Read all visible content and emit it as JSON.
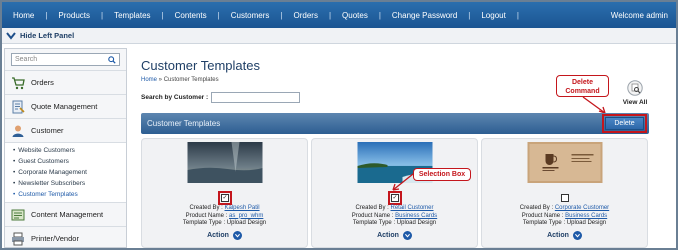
{
  "topnav": {
    "items": [
      "Home",
      "Products",
      "Templates",
      "Contents",
      "Customers",
      "Orders",
      "Quotes",
      "Change Password",
      "Logout"
    ],
    "welcome": "Welcome admin"
  },
  "hidebar": {
    "label": "Hide Left Panel"
  },
  "sidebar": {
    "search_placeholder": "Search",
    "items": [
      {
        "label": "Orders",
        "icon": "cart-icon"
      },
      {
        "label": "Quote Management",
        "icon": "quote-icon"
      },
      {
        "label": "Customer",
        "icon": "customer-icon"
      }
    ],
    "subitems": [
      "Website Customers",
      "Guest Customers",
      "Corporate Management",
      "Newsletter Subscribers",
      "Customer Templates"
    ],
    "after": [
      {
        "label": "Content Management",
        "icon": "content-icon"
      },
      {
        "label": "Printer/Vendor",
        "icon": "printer-icon"
      }
    ]
  },
  "main": {
    "title": "Customer Templates",
    "breadcrumb": {
      "home": "Home",
      "sep": " » ",
      "current": "Customer Templates"
    },
    "search_label": "Search by Customer :",
    "view_all": "View All",
    "bar_title": "Customer Templates",
    "delete_label": "Delete",
    "callouts": {
      "delete": "Delete Command",
      "selection": "Selection Box"
    },
    "cards": [
      {
        "created_label": "Created By :",
        "created_by": "Kalpesh Patil",
        "product_label": "Product Name :",
        "product": "as_pro_whm",
        "type_label": "Template Type :",
        "type": "Upload Design",
        "checked": true,
        "action": "Action"
      },
      {
        "created_label": "Created By :",
        "created_by": "Retail Customer",
        "product_label": "Product Name :",
        "product": "Business Cards",
        "type_label": "Template Type :",
        "type": "Upload Design",
        "checked": true,
        "action": "Action"
      },
      {
        "created_label": "Created By :",
        "created_by": "Corporate Customer",
        "product_label": "Product Name :",
        "product": "Business Cards",
        "type_label": "Template Type :",
        "type": "Upload Design",
        "checked": false,
        "action": "Action"
      }
    ]
  },
  "colors": {
    "nav": "#1b5592",
    "accent": "#1e5aa8",
    "callout": "#c4161c"
  }
}
